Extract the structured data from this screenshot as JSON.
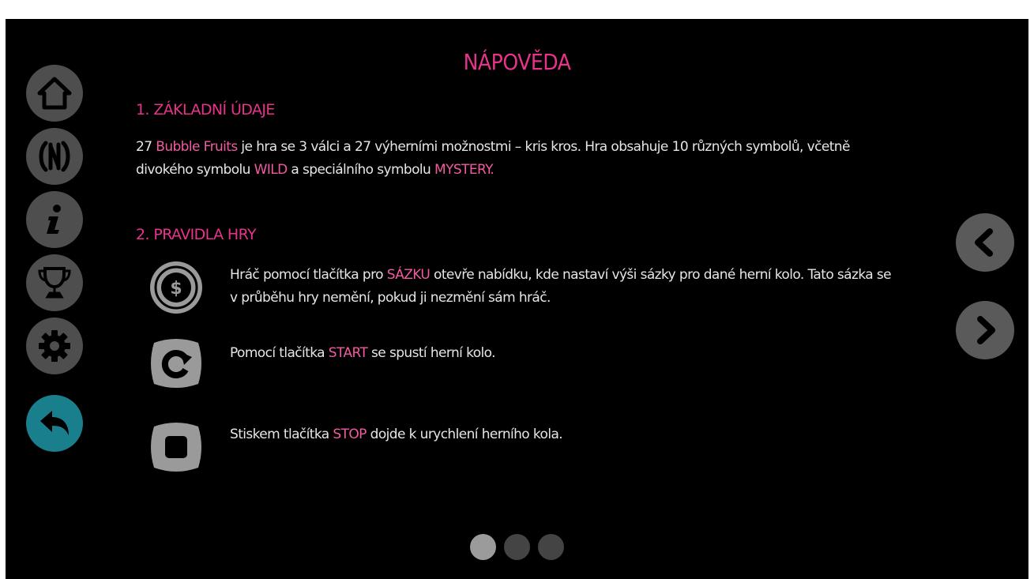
{
  "title": "NÁPOVĚDA",
  "sidebar": [
    {
      "name": "home-icon"
    },
    {
      "name": "paytable-icon"
    },
    {
      "name": "info-icon"
    },
    {
      "name": "trophy-icon"
    },
    {
      "name": "gear-icon"
    },
    {
      "name": "back-icon",
      "active": true
    }
  ],
  "section1": {
    "title": "1. ZÁKLADNÍ ÚDAJE",
    "p1a": "27 ",
    "p1b": "Bubble Fruits",
    "p1c": " je hra se 3 válci a 27 výherními možnostmi – kris kros. Hra obsahuje 10 různých symbolů, včetně",
    "p2a": "divokého symbolu ",
    "p2b": "WILD",
    "p2c": " a speciálního symbolu ",
    "p2d": "MYSTERY."
  },
  "section2": {
    "title": "2. PRAVIDLA HRY",
    "rule1": {
      "a": "Hráč pomocí tlačítka pro ",
      "b": "SÁZKU",
      "c": " otevře nabídku, kde nastaví výši sázky pro dané herní kolo. Tato sázka se",
      "d": "v průběhu hry nemění, pokud ji nezmění sám hráč."
    },
    "rule2": {
      "a": "Pomocí tlačítka ",
      "b": "START",
      "c": " se spustí herní kolo."
    },
    "rule3": {
      "a": "Stiskem tlačítka ",
      "b": "STOP",
      "c": " dojde k urychlení herního kola."
    },
    "bet_icon_symbol": "$"
  },
  "pagination": {
    "current": 1,
    "total": 3
  },
  "colors": {
    "accent_pink": "#e8338b",
    "highlight_pink": "#f25aa1",
    "teal_active": "#1a7f8c",
    "button_gray": "#4e4e4e"
  }
}
